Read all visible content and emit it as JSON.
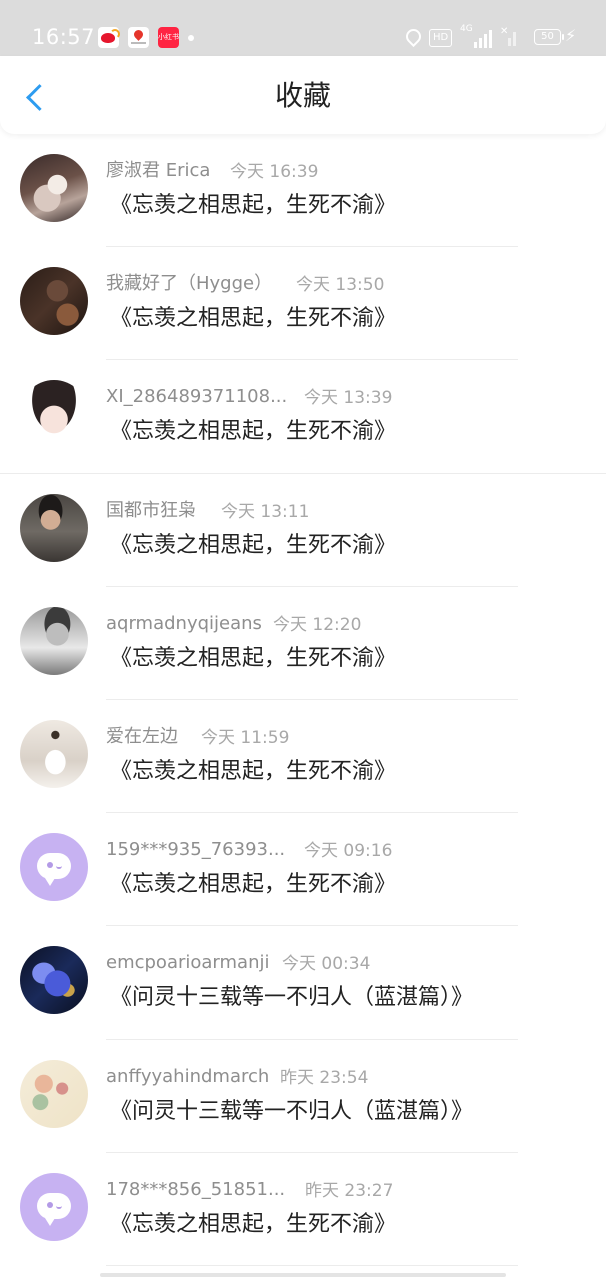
{
  "status_bar": {
    "time": "16:57",
    "network_label": "4G",
    "hd_label": "HD",
    "battery_level": "50",
    "notification_shop_label": "小红书"
  },
  "header": {
    "title": "收藏"
  },
  "favorites": [
    {
      "user": "廖淑君 Erica",
      "time": "今天 16:39",
      "title": "《忘羡之相思起，生死不渝》",
      "avatar": "photo-bed"
    },
    {
      "user": "我藏好了（Hygge）",
      "time": "今天 13:50",
      "title": "《忘羡之相思起，生死不渝》",
      "avatar": "photo-dark-portrait"
    },
    {
      "user": "XI_286489371108...",
      "time": "今天 13:39",
      "title": "《忘羡之相思起，生死不渝》",
      "avatar": "anime-girl"
    },
    {
      "user": "国都市狂枭",
      "time": "今天 13:11",
      "title": "《忘羡之相思起，生死不渝》",
      "avatar": "photo-man-sweater"
    },
    {
      "user": "aqrmadnyqijeans",
      "time": "今天 12:20",
      "title": "《忘羡之相思起，生死不渝》",
      "avatar": "photo-bw-man"
    },
    {
      "user": "爱在左边",
      "time": "今天 11:59",
      "title": "《忘羡之相思起，生死不渝》",
      "avatar": "photo-ballerina"
    },
    {
      "user": "159***935_76393...",
      "time": "今天 09:16",
      "title": "《忘羡之相思起，生死不渝》",
      "avatar": "default-chat-face"
    },
    {
      "user": "emcpoarioarmanji",
      "time": "今天 00:34",
      "title": "《问灵十三载等一不归人（蓝湛篇）》",
      "avatar": "photo-betta-fish"
    },
    {
      "user": "anffyyahindmarch",
      "time": "昨天 23:54",
      "title": "《问灵十三载等一不归人（蓝湛篇）》",
      "avatar": "photo-flowers"
    },
    {
      "user": "178***856_51851...",
      "time": "昨天 23:27",
      "title": "《忘羡之相思起，生死不渝》",
      "avatar": "default-chat-face"
    }
  ],
  "colors": {
    "accent": "#2d9cf0",
    "status_bar_bg": "#dcdcdc",
    "default_avatar_bg": "#c7b2f2"
  }
}
